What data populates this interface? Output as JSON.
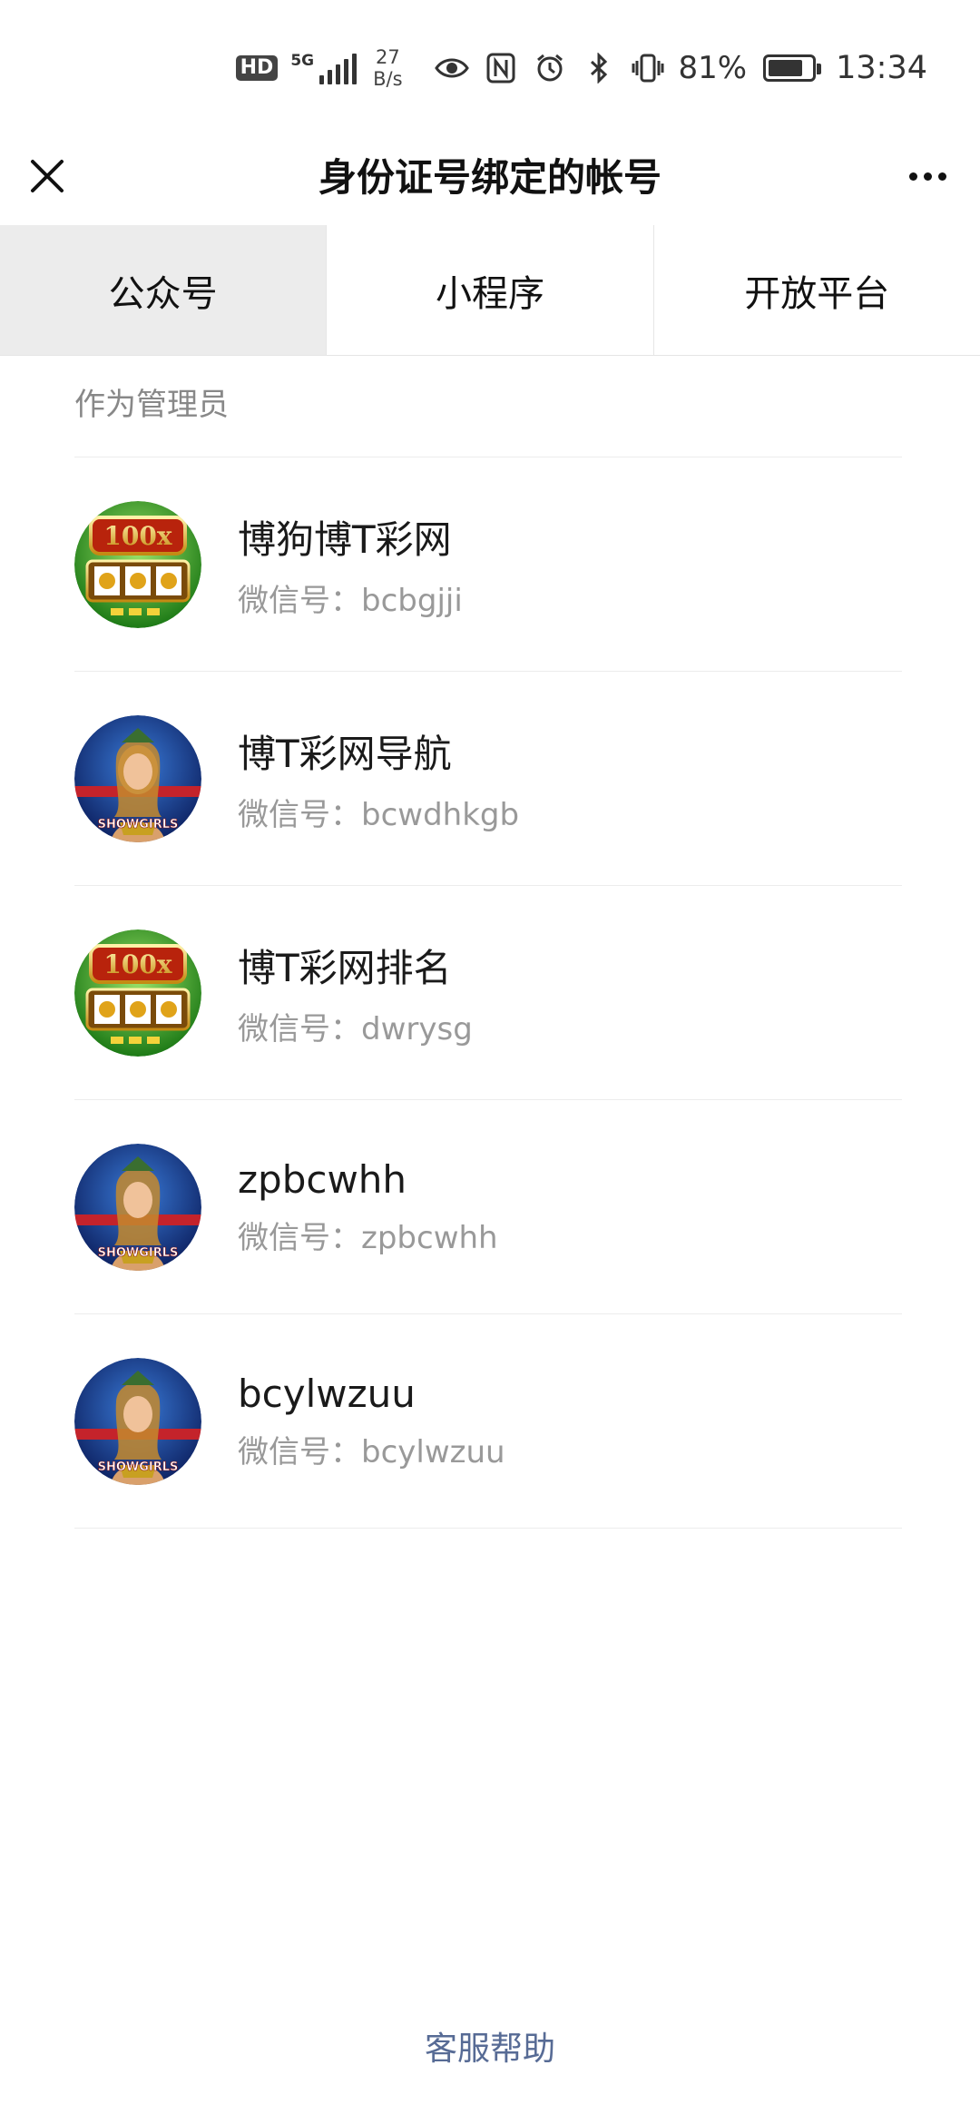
{
  "status_bar": {
    "hd": "HD",
    "network": "5G",
    "speed_value": "27",
    "speed_unit": "B/s",
    "battery_text": "81%",
    "battery_level": 0.81,
    "time": "13:34",
    "icons": [
      "eye-icon",
      "nfc-icon",
      "alarm-icon",
      "bluetooth-icon",
      "vibrate-icon"
    ]
  },
  "nav": {
    "title": "身份证号绑定的帐号",
    "close_icon": "close-icon",
    "more_icon": "more-icon"
  },
  "tabs": [
    {
      "label": "公众号",
      "active": true
    },
    {
      "label": "小程序",
      "active": false
    },
    {
      "label": "开放平台",
      "active": false
    }
  ],
  "section": {
    "header": "作为管理员"
  },
  "accounts": [
    {
      "name": "博狗博T彩网",
      "id_label": "微信号：",
      "id": "bcbgjji",
      "avatar": "slot-machine-avatar"
    },
    {
      "name": "博T彩网导航",
      "id_label": "微信号：",
      "id": "bcwdhkgb",
      "avatar": "showgirls-avatar"
    },
    {
      "name": "博T彩网排名",
      "id_label": "微信号：",
      "id": "dwrysg",
      "avatar": "slot-machine-avatar"
    },
    {
      "name": "zpbcwhh",
      "id_label": "微信号：",
      "id": "zpbcwhh",
      "avatar": "showgirls-avatar"
    },
    {
      "name": "bcylwzuu",
      "id_label": "微信号：",
      "id": "bcylwzuu",
      "avatar": "showgirls-avatar"
    }
  ],
  "footer": {
    "help": "客服帮助"
  },
  "colors": {
    "link": "#576b95",
    "active_tab_bg": "#ececec",
    "secondary_text": "#999999"
  }
}
